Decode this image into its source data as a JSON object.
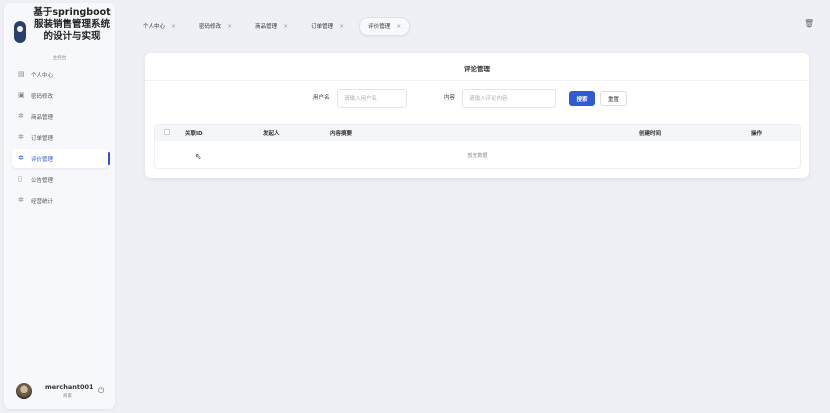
{
  "app": {
    "title": "基于springboot服装销售管理系统的设计与实现",
    "role_label": "主控台"
  },
  "sidebar": {
    "items": [
      {
        "label": "个人中心",
        "icon": "user-card-icon",
        "active": false
      },
      {
        "label": "密码修改",
        "icon": "lock-icon",
        "active": false
      },
      {
        "label": "商品管理",
        "icon": "gear-icon",
        "active": false
      },
      {
        "label": "订单管理",
        "icon": "gear-icon",
        "active": false
      },
      {
        "label": "评价管理",
        "icon": "gear-icon",
        "active": true
      },
      {
        "label": "公告管理",
        "icon": "document-icon",
        "active": false
      },
      {
        "label": "经营统计",
        "icon": "gear-icon",
        "active": false
      }
    ]
  },
  "user": {
    "name": "merchant001",
    "role": "商家"
  },
  "tabs": [
    {
      "label": "个人中心",
      "active": false
    },
    {
      "label": "密码修改",
      "active": false
    },
    {
      "label": "商品管理",
      "active": false
    },
    {
      "label": "订单管理",
      "active": false
    },
    {
      "label": "评价管理",
      "active": true
    }
  ],
  "main": {
    "title": "评论管理",
    "filters": {
      "username_label": "用户名",
      "username_placeholder": "请输入用户名",
      "username_value": "",
      "content_label": "内容",
      "content_placeholder": "请输入评论内容",
      "content_value": ""
    },
    "search_label": "搜索",
    "reset_label": "重置",
    "table": {
      "columns": [
        "关联ID",
        "发起人",
        "内容摘要",
        "创建时间",
        "操作"
      ],
      "rows": [],
      "empty_text": "暂无数据"
    }
  },
  "colors": {
    "accent": "#2f5bd3",
    "background": "#eef0f6"
  }
}
